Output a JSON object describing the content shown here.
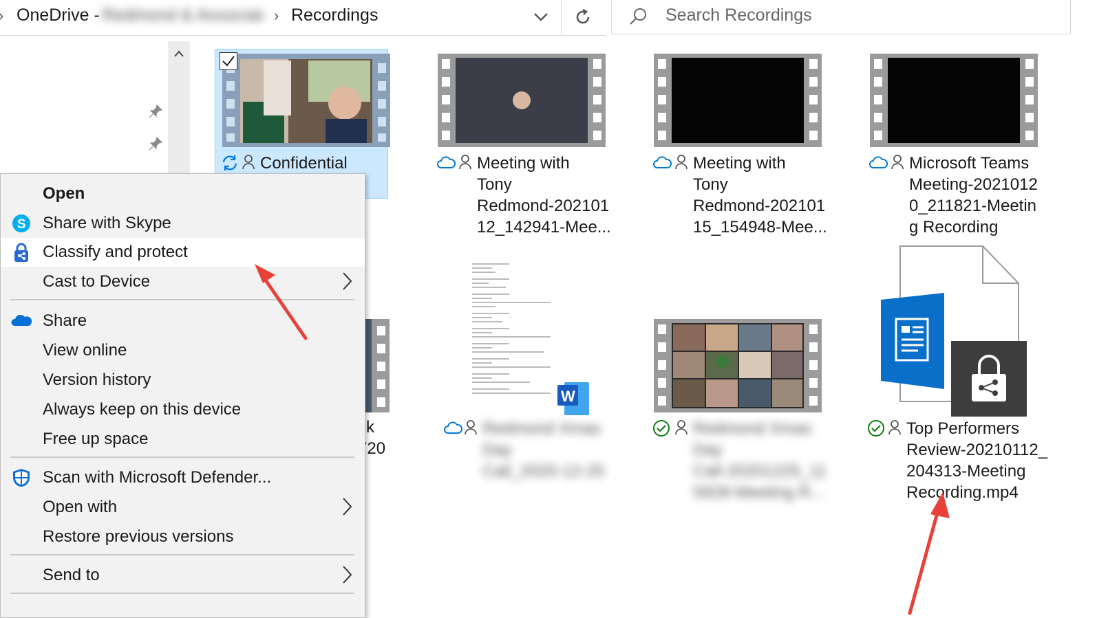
{
  "address_bar": {
    "root": "OneDrive -",
    "org": "Redmond & Associates",
    "folder": "Recordings"
  },
  "search": {
    "placeholder": "Search Recordings"
  },
  "files": [
    {
      "name": "Confidential\nMeeting",
      "status": "syncing",
      "type": "video"
    },
    {
      "name": "Meeting with\nTony\nRedmond-202101\n12_142941-Mee...",
      "status": "cloud",
      "type": "video"
    },
    {
      "name": "Meeting with\nTony\nRedmond-202101\n15_154948-Mee...",
      "status": "cloud",
      "type": "video"
    },
    {
      "name": "Microsoft Teams\nMeeting-2021012\n0_211821-Meetin\ng Recording",
      "status": "cloud",
      "type": "video"
    },
    {
      "name": "...ck\n...720",
      "status": "",
      "type": "video"
    },
    {
      "name": "Redmond Xmas\nDay\nCall_2020-12-25",
      "status": "cloud",
      "type": "word"
    },
    {
      "name": "Redmond Xmas\nDay\nCall-20201225_11\n5928-Meeting R...",
      "status": "synced",
      "type": "video"
    },
    {
      "name": "Top Performers\nReview-20210112_\n204313-Meeting\nRecording.mp4",
      "status": "synced",
      "type": "protected"
    }
  ],
  "context_menu": {
    "items": [
      {
        "label": "Open",
        "bold": true
      },
      {
        "label": "Share with Skype",
        "icon": "skype-icon"
      },
      {
        "label": "Classify and protect",
        "icon": "classify-protect-icon",
        "highlighted": true
      },
      {
        "label": "Cast to Device",
        "submenu": true
      },
      {
        "label": "Share",
        "icon": "onedrive-cloud-icon"
      },
      {
        "label": "View online"
      },
      {
        "label": "Version history"
      },
      {
        "label": "Always keep on this device"
      },
      {
        "label": "Free up space"
      },
      {
        "label": "Scan with Microsoft Defender...",
        "icon": "defender-shield-icon"
      },
      {
        "label": "Open with",
        "submenu": true
      },
      {
        "label": "Restore previous versions"
      },
      {
        "label": "Send to",
        "submenu": true
      }
    ]
  },
  "colors": {
    "selection": "#cce8ff",
    "onedrive_blue": "#0078d4",
    "synced_green": "#107c10",
    "annotation_red": "#e8413a",
    "word_blue": "#185abd",
    "menu_bg": "#f2f2f2"
  }
}
